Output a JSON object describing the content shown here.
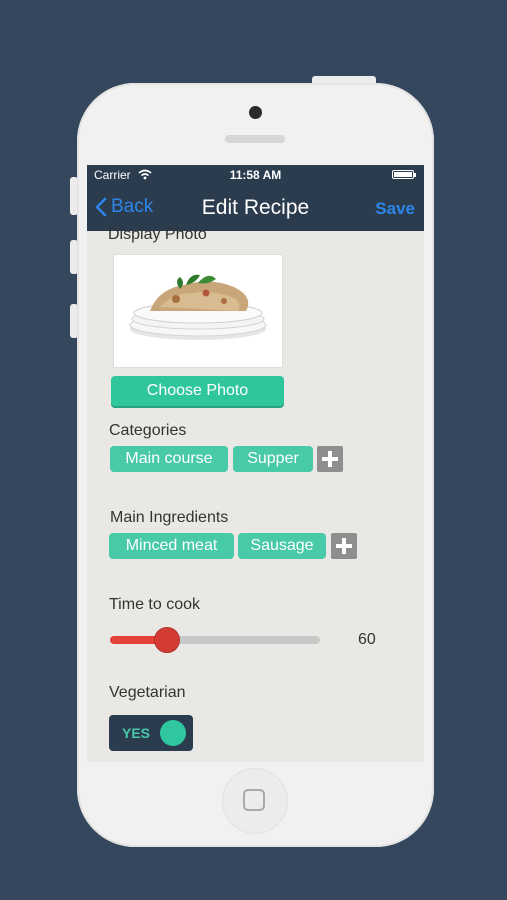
{
  "status_bar": {
    "carrier": "Carrier",
    "time": "11:58 AM"
  },
  "nav": {
    "back_label": "Back",
    "title": "Edit Recipe",
    "save_label": "Save"
  },
  "photo_section": {
    "label": "Display Photo",
    "choose_button": "Choose Photo"
  },
  "categories": {
    "label": "Categories",
    "tags": [
      "Main course",
      "Supper"
    ]
  },
  "ingredients": {
    "label": "Main Ingredients",
    "tags": [
      "Minced meat",
      "Sausage"
    ]
  },
  "time_to_cook": {
    "label": "Time to cook",
    "value": "60",
    "slider_fraction": 0.27
  },
  "vegetarian": {
    "label": "Vegetarian",
    "toggle_text": "YES",
    "on": true
  },
  "colors": {
    "background": "#34475c",
    "navbar": "#2b3c4f",
    "accent_blue": "#2c86e8",
    "tag_green": "#48c9a8",
    "slider_red": "#e4413b"
  },
  "icons": [
    "wifi-icon",
    "battery-icon",
    "chevron-left-icon",
    "plus-icon",
    "home-button-icon"
  ]
}
